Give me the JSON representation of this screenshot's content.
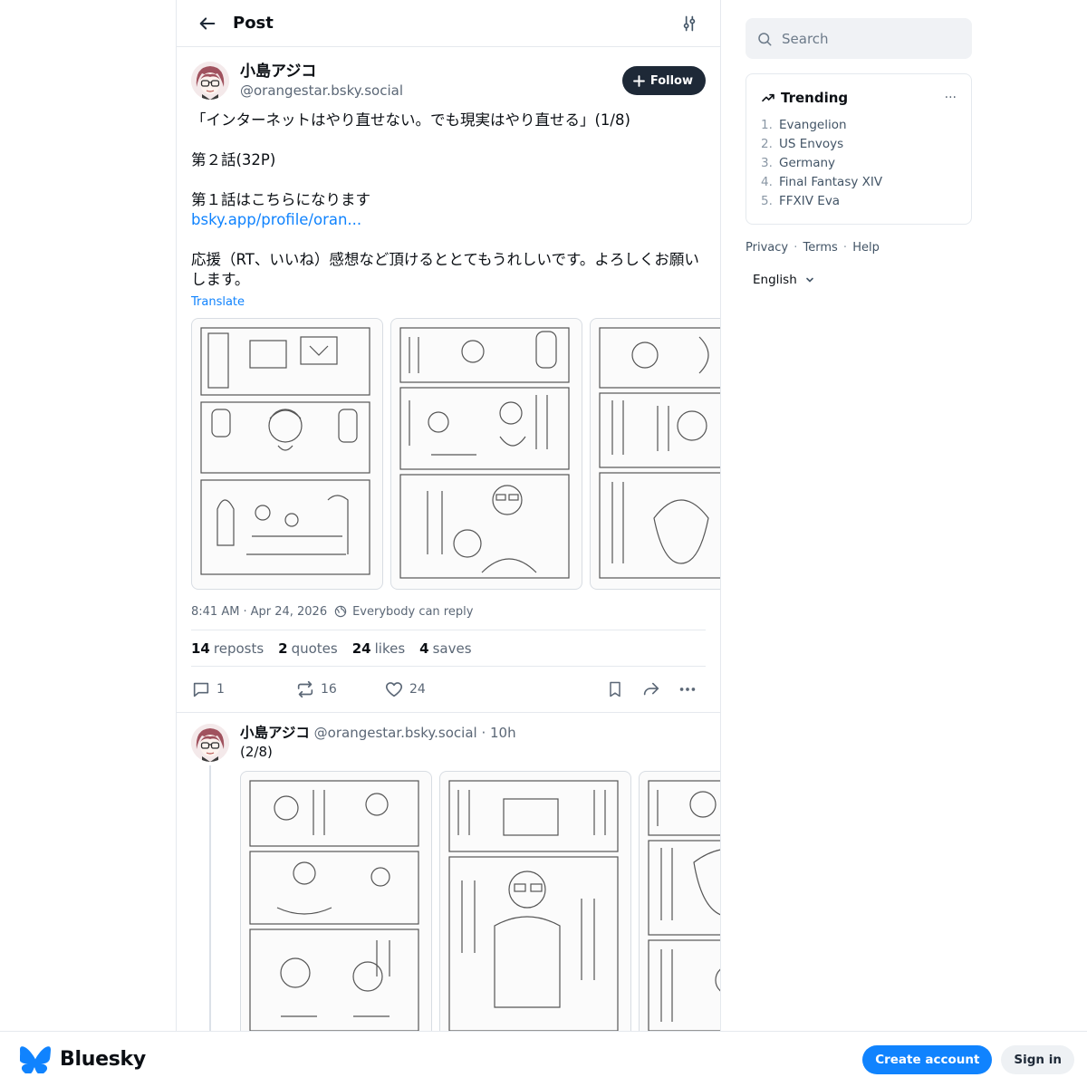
{
  "header": {
    "title": "Post"
  },
  "post": {
    "display_name": "小島アジコ",
    "handle": "@orangestar.bsky.social",
    "follow_label": "Follow",
    "text": {
      "line1": "「インターネットはやり直せない。でも現実はやり直せる」(1/8)",
      "line2": "第２話(32P)",
      "line3": "第１話はこちらになります",
      "link": "bsky.app/profile/oran...",
      "line4": "応援（RT、いいね）感想など頂けるととてもうれしいです。よろしくお願いします。"
    },
    "translate_label": "Translate",
    "time": "8:41 AM",
    "date": "Apr 24, 2026",
    "reply_setting": "Everybody can reply",
    "stats": {
      "reposts_count": "14",
      "reposts_label": "reposts",
      "quotes_count": "2",
      "quotes_label": "quotes",
      "likes_count": "24",
      "likes_label": "likes",
      "saves_count": "4",
      "saves_label": "saves"
    },
    "actions": {
      "reply_count": "1",
      "repost_count": "16",
      "like_count": "24"
    }
  },
  "reply": {
    "display_name": "小島アジコ",
    "handle": "@orangestar.bsky.social",
    "age": "10h",
    "text": "(2/8)"
  },
  "search": {
    "placeholder": "Search"
  },
  "trending": {
    "title": "Trending",
    "items": [
      {
        "num": "1.",
        "label": "Evangelion"
      },
      {
        "num": "2.",
        "label": "US Envoys"
      },
      {
        "num": "3.",
        "label": "Germany"
      },
      {
        "num": "4.",
        "label": "Final Fantasy XIV"
      },
      {
        "num": "5.",
        "label": "FFXIV Eva"
      }
    ]
  },
  "footer": {
    "privacy": "Privacy",
    "terms": "Terms",
    "help": "Help",
    "language": "English"
  },
  "bottombar": {
    "brand": "Bluesky",
    "create_account": "Create account",
    "sign_in": "Sign in"
  },
  "colors": {
    "accent": "#1083fe",
    "follow_bg": "#1e2937",
    "muted": "#5b6776"
  }
}
